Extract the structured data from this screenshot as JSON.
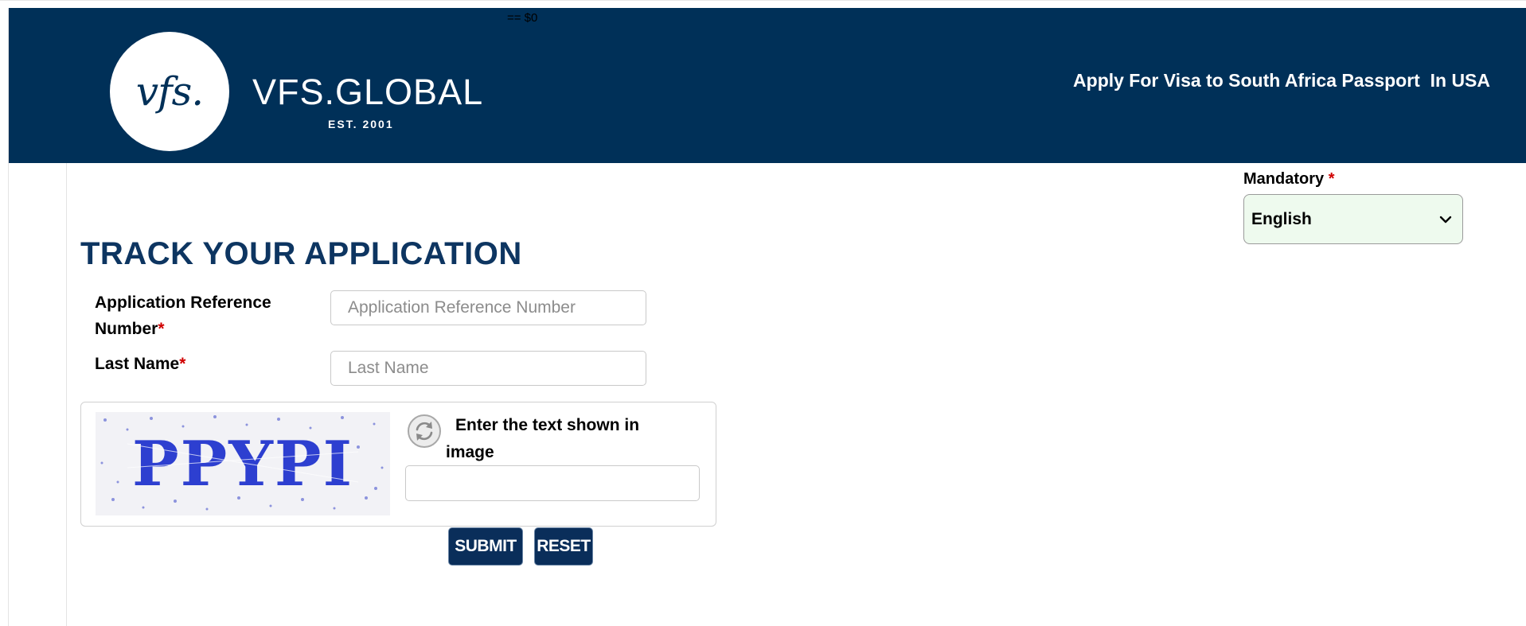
{
  "devtools": {
    "marker": "== $0"
  },
  "header": {
    "logo_mark": "vfs.",
    "logo_word": "VFS.GLOBAL",
    "logo_est": "EST. 2001",
    "title": "Apply For Visa to South Africa Passport  In USA"
  },
  "language": {
    "label": "Mandatory",
    "required_mark": "*",
    "selected": "English"
  },
  "page": {
    "title": "TRACK YOUR APPLICATION"
  },
  "form": {
    "reference": {
      "label_line1": "Application Reference",
      "label_line2": "Number",
      "required_mark": "*",
      "placeholder": "Application Reference Number"
    },
    "last_name": {
      "label": "Last Name",
      "required_mark": "*",
      "placeholder": "Last Name"
    },
    "captcha": {
      "image_text": "PPYPI",
      "label": "Enter the text shown in image"
    },
    "submit_label": "SUBMIT",
    "reset_label": "RESET"
  },
  "colors": {
    "header_bg": "#003058",
    "title": "#0d3561",
    "button_bg": "#0a2e5a",
    "required": "#d00000",
    "select_bg": "#eefaee"
  },
  "icons": [
    "refresh-icon",
    "chevron-down-icon"
  ]
}
